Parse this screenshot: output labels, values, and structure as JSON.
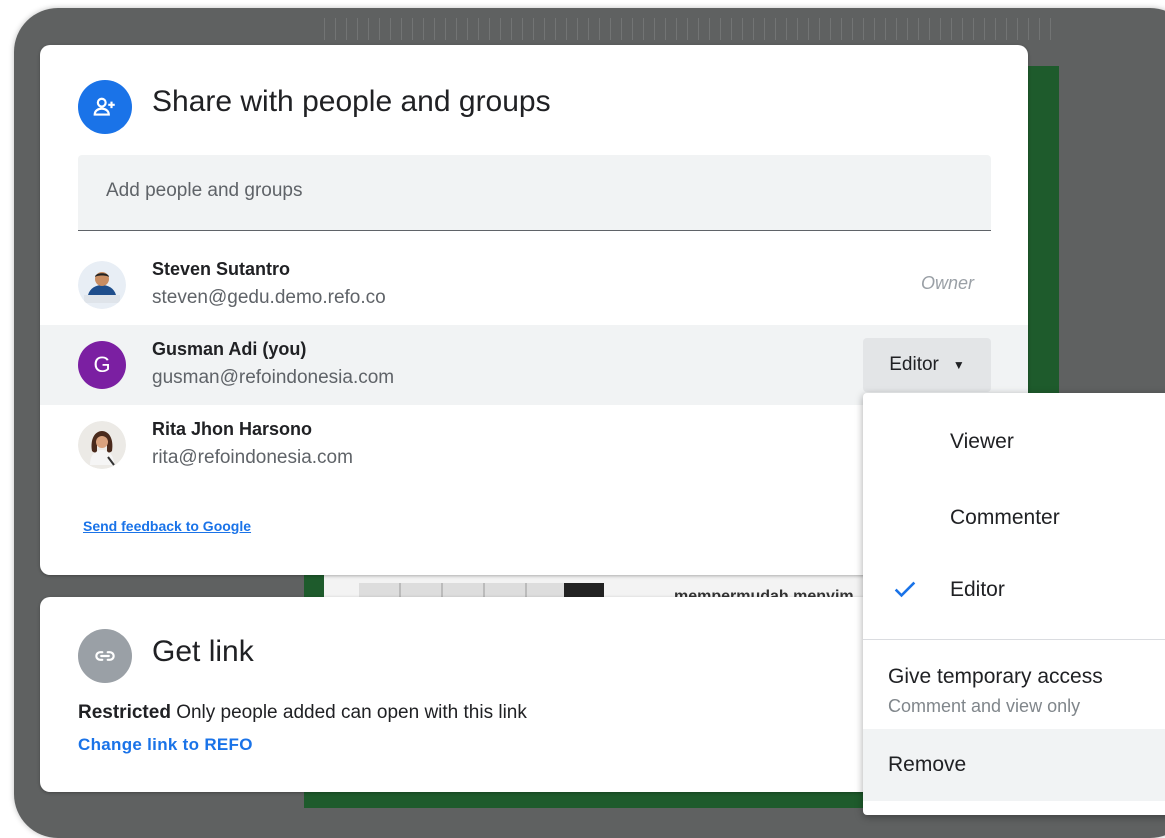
{
  "share": {
    "title": "Share with people and groups",
    "add_placeholder": "Add people and groups",
    "people": [
      {
        "name": "Steven Sutantro",
        "email": "steven@gedu.demo.refo.co",
        "role": "Owner"
      },
      {
        "name": "Gusman Adi (you)",
        "email": "gusman@refoindonesia.com",
        "role": "Editor",
        "avatar_letter": "G"
      },
      {
        "name": "Rita Jhon Harsono",
        "email": "rita@refoindonesia.com"
      }
    ],
    "feedback": "Send feedback to Google"
  },
  "link": {
    "title": "Get link",
    "restricted_bold": "Restricted",
    "restricted_text": "Only people added can open with this link",
    "change": "Change link to REFO"
  },
  "menu": {
    "options": [
      "Viewer",
      "Commenter",
      "Editor"
    ],
    "selected": "Editor",
    "temp_title": "Give temporary access",
    "temp_sub": "Comment and view only",
    "remove": "Remove"
  },
  "background": {
    "doc_snippet": "mempermudah menyim"
  },
  "colors": {
    "accent": "#1a73e8",
    "avatar_purple": "#7b1fa2",
    "backdrop": "#5f6161",
    "doc_green": "#1e5b2c"
  },
  "icons": {
    "share": "person-add-icon",
    "link": "link-icon",
    "check": "check-icon",
    "caret": "caret-down-icon"
  }
}
